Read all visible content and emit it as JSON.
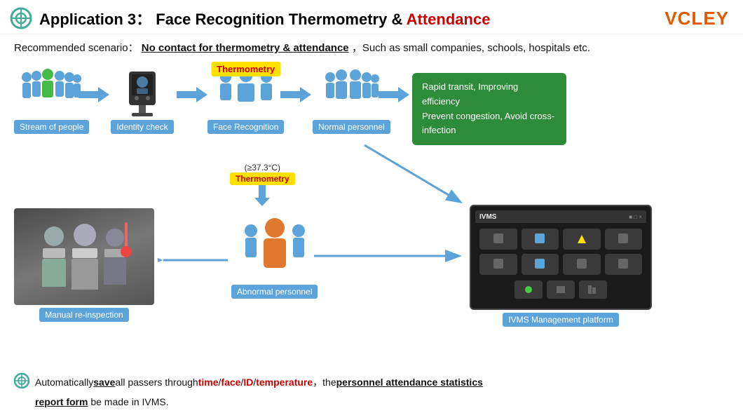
{
  "header": {
    "app_number": "Application 3",
    "colon": "：",
    "title_plain": "Face Recognition Thermometry & ",
    "title_red": "Attendance",
    "logo": "VCLEY"
  },
  "scenario": {
    "label": "Recommended scenario：",
    "underline_text": "No contact for thermometry & attendance",
    "rest": "，Such as small companies, schools, hospitals etc."
  },
  "flow": {
    "stream_label": "Stream of people",
    "identity_label": "Identity check",
    "face_label": "Face Recognition",
    "normal_label": "Normal personnel",
    "thermometry_badge": "Thermometry",
    "green_line1": "Rapid transit, Improving efficiency",
    "green_line2": "Prevent congestion, Avoid cross-infection",
    "temp_threshold": "(≥37.3°C)",
    "thermometry_down": "Thermometry",
    "abnormal_label": "Abnormal personnel",
    "manual_label": "Manual re-inspection",
    "ivms_topbar": "IVMS",
    "ivms_label": "IVMS Management platform"
  },
  "note": {
    "prefix": "Automatically ",
    "save_bold": "save",
    "middle": " all passers through ",
    "time": "time",
    "slash1": " / ",
    "face": "face",
    "slash2": " / ",
    "id": "ID",
    "slash3": " / ",
    "temperature": "temperature",
    "comma": "，",
    "the": "  the ",
    "stats": "personnel attendance statistics",
    "newline": "report form",
    "end": " be made in IVMS."
  },
  "colors": {
    "blue": "#5ba3d9",
    "red": "#cc0000",
    "green": "#2e8b3a",
    "yellow": "#ffe000",
    "orange": "#e05a00",
    "dark": "#1a1a1a"
  }
}
